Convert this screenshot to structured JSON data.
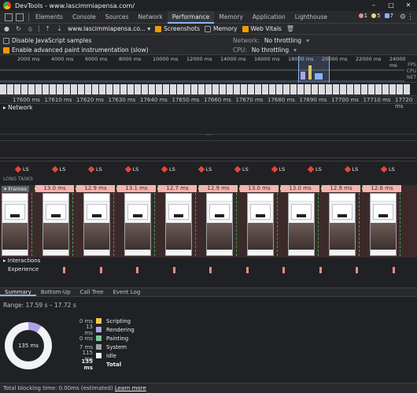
{
  "window": {
    "title": "DevTools - www.lascimmiapensa.com/",
    "min": "–",
    "max": "□",
    "close": "✕"
  },
  "tabs": [
    "Elements",
    "Console",
    "Sources",
    "Network",
    "Performance",
    "Memory",
    "Application",
    "Lighthouse"
  ],
  "active_tab": "Performance",
  "counters": {
    "errors": "1",
    "warnings": "5",
    "info": "7"
  },
  "toolbar": {
    "profile": "www.lascimmiapensa.co...",
    "screenshots": "Screenshots",
    "memory": "Memory",
    "web_vitals": "Web Vitals"
  },
  "options": {
    "disable_js": "Disable JavaScript samples",
    "enable_paint": "Enable advanced paint instrumentation (slow)",
    "network_label": "Network:",
    "network_value": "No throttling",
    "cpu_label": "CPU:",
    "cpu_value": "No throttling"
  },
  "overview_ticks": [
    "2000 ms",
    "4000 ms",
    "6000 ms",
    "8000 ms",
    "10000 ms",
    "12000 ms",
    "14000 ms",
    "16000 ms",
    "18000 ms",
    "20000 ms",
    "22000 ms",
    "24000 ms"
  ],
  "overview_labels": [
    "FPS",
    "CPU",
    "NET"
  ],
  "ruler_ticks": [
    "17600 ms",
    "17610 ms",
    "17620 ms",
    "17630 ms",
    "17640 ms",
    "17650 ms",
    "17660 ms",
    "17670 ms",
    "17680 ms",
    "17690 ms",
    "17700 ms",
    "17710 ms",
    "17720 ms"
  ],
  "network_track": "Network",
  "ls_label": "LS",
  "long_tasks": "LONG TASKS",
  "frames_label": "Frames",
  "frame_times": [
    "13.0 ms",
    "12.9 ms",
    "13.1 ms",
    "12.7 ms",
    "12.9 ms",
    "13.0 ms",
    "13.0 ms",
    "12.9 ms",
    "12.6 ms"
  ],
  "interactions": "Interactions",
  "experience": "Experience",
  "bottom_tabs": [
    "Summary",
    "Bottom-Up",
    "Call Tree",
    "Event Log"
  ],
  "range": "Range: 17.59 s – 17.72 s",
  "donut_total": "135 ms",
  "summary": [
    {
      "value": "0 ms",
      "name": "Scripting",
      "color": "#f2c94c"
    },
    {
      "value": "13 ms",
      "name": "Rendering",
      "color": "#b1a0e8"
    },
    {
      "value": "0 ms",
      "name": "Painting",
      "color": "#81c995"
    },
    {
      "value": "7 ms",
      "name": "System",
      "color": "#9aa0a6"
    },
    {
      "value": "115 ms",
      "name": "Idle",
      "color": "#f1f3f4"
    }
  ],
  "total": {
    "value": "135 ms",
    "name": "Total"
  },
  "status": {
    "text": "Total blocking time: 0.00ms (estimated)",
    "link": "Learn more"
  }
}
